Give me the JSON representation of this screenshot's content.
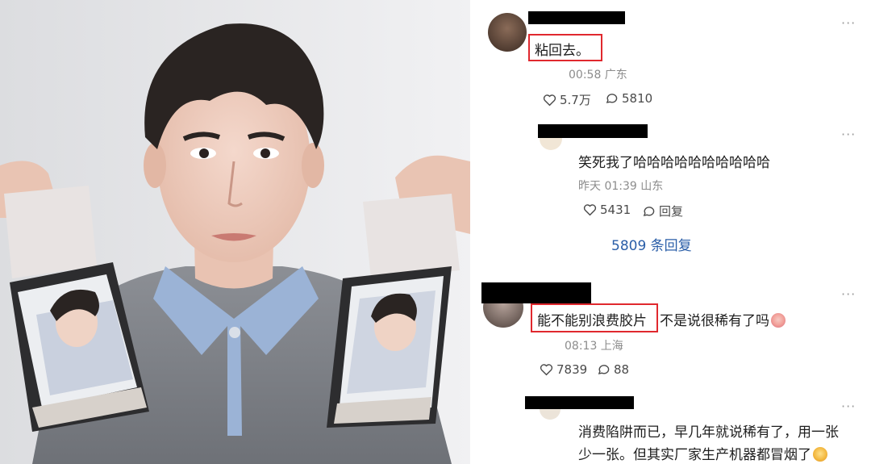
{
  "photo": {
    "alt": "Man holding two instant photos"
  },
  "comments": [
    {
      "text": "粘回去。",
      "meta": "00:58 广东",
      "likes": "5.7万",
      "replies": "5810"
    },
    {
      "text": "笑死我了哈哈哈哈哈哈哈哈哈哈",
      "meta": "昨天 01:39 山东",
      "likes": "5431",
      "reply_label": "回复"
    },
    {
      "replies_link": "5809 条回复"
    },
    {
      "text_highlight": "能不能别浪费胶片",
      "text_rest": "不是说很稀有了吗",
      "meta": "08:13 上海",
      "likes": "7839",
      "replies": "88"
    },
    {
      "text_line1": "消费陷阱而已，早几年就说稀有了，用一张",
      "text_line2": "少一张。但其实厂家生产机器都冒烟了"
    }
  ],
  "more_label": "···",
  "colors": {
    "highlight_border": "#e0282e",
    "link": "#2a5ea8",
    "redaction": "#000000"
  }
}
